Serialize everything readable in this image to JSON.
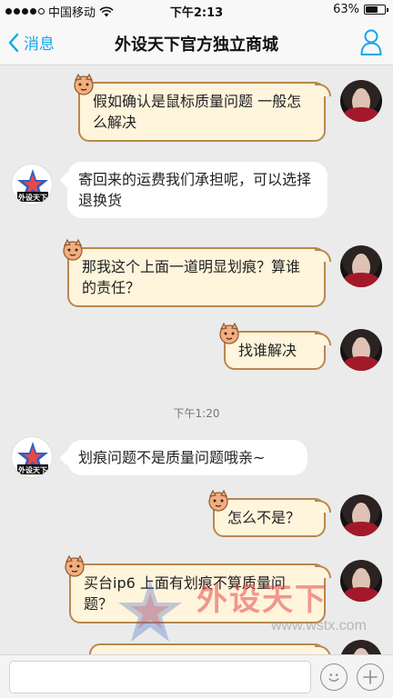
{
  "status_bar": {
    "carrier": "中国移动",
    "time": "下午2:13",
    "battery": "63%",
    "battery_level": 0.63
  },
  "nav": {
    "back_label": "消息",
    "title": "外设天下官方独立商城",
    "back_icon": "chevron-left-icon",
    "profile_icon": "person-icon",
    "accent": "#12a5ec"
  },
  "messages": [
    {
      "sender": "me",
      "text": "假如确认是鼠标质量问题 一般怎么解决"
    },
    {
      "sender": "shop",
      "text": "寄回来的运费我们承担呢，可以选择退换货"
    },
    {
      "sender": "me",
      "text": "那我这个上面一道明显划痕？算谁的责任？"
    },
    {
      "sender": "me",
      "text": "找谁解决"
    },
    {
      "sender": "shop",
      "text": "划痕问题不是质量问题哦亲~"
    },
    {
      "sender": "me",
      "text": "怎么不是？"
    },
    {
      "sender": "me",
      "text": "买台ip6 上面有划痕不算质量问题？"
    }
  ],
  "timestamp": "下午1:20",
  "shop_avatar_text": "外设天下",
  "watermark": {
    "text": "外设天下",
    "url": "www.wstx.com"
  },
  "input_bar": {
    "placeholder": "",
    "emoji_icon": "smiley-icon",
    "plus_icon": "plus-icon"
  }
}
